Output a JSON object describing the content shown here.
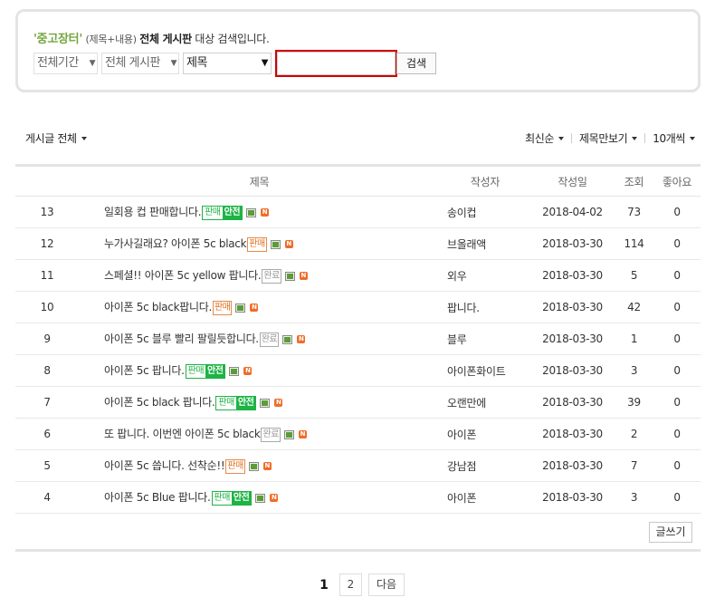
{
  "search": {
    "cafe_name": "'중고장터'",
    "scope_small": "(제목+내용)",
    "scope_bold": "전체 게시판",
    "scope_suffix": "대상 검색입니다.",
    "period": "전체기간",
    "board": "전체 게시판",
    "field": "제목",
    "query": "",
    "button": "검색"
  },
  "toolbar": {
    "filter": "게시글 전체",
    "sort": "최신순",
    "view": "제목만보기",
    "per_page": "10개씩"
  },
  "table": {
    "headers": {
      "title": "제목",
      "author": "작성자",
      "date": "작성일",
      "views": "조회",
      "likes": "좋아요"
    },
    "rows": [
      {
        "num": "13",
        "title": "일회용 컵 판매합니다.",
        "tag": "sale-safe",
        "author": "송이컵",
        "date": "2018-04-02",
        "views": "73",
        "likes": "0"
      },
      {
        "num": "12",
        "title": "누가사길래요? 아이폰 5c black",
        "tag": "sale",
        "author": "브올래액",
        "date": "2018-03-30",
        "views": "114",
        "likes": "0"
      },
      {
        "num": "11",
        "title": "스페셜!! 아이폰 5c yellow 팝니다.",
        "tag": "done",
        "author": "외우",
        "date": "2018-03-30",
        "views": "5",
        "likes": "0"
      },
      {
        "num": "10",
        "title": "아이폰 5c black팝니다.",
        "tag": "sale",
        "author": "팝니다.",
        "date": "2018-03-30",
        "views": "42",
        "likes": "0"
      },
      {
        "num": "9",
        "title": "아이폰 5c 블루 빨리 팔릴듯합니다.",
        "tag": "done",
        "author": "블루",
        "date": "2018-03-30",
        "views": "1",
        "likes": "0"
      },
      {
        "num": "8",
        "title": "아이폰 5c 팝니다.",
        "tag": "sale-safe",
        "author": "아이폰화이트",
        "date": "2018-03-30",
        "views": "3",
        "likes": "0"
      },
      {
        "num": "7",
        "title": "아이폰 5c black 팝니다.",
        "tag": "sale-safe",
        "author": "오랜만에",
        "date": "2018-03-30",
        "views": "39",
        "likes": "0"
      },
      {
        "num": "6",
        "title": "또 팝니다. 이번엔 아이폰 5c black",
        "tag": "done",
        "author": "아이폰",
        "date": "2018-03-30",
        "views": "2",
        "likes": "0"
      },
      {
        "num": "5",
        "title": "아이폰 5c 씁니다. 선착순!!",
        "tag": "sale",
        "author": "강남점",
        "date": "2018-03-30",
        "views": "7",
        "likes": "0"
      },
      {
        "num": "4",
        "title": "아이폰 5c Blue 팝니다.",
        "tag": "sale-safe",
        "author": "아이폰",
        "date": "2018-03-30",
        "views": "3",
        "likes": "0"
      }
    ]
  },
  "tags": {
    "sale": "판매",
    "safe": "안전",
    "done": "완료",
    "new": "N"
  },
  "write_button": "글쓰기",
  "pagination": {
    "current": "1",
    "next_page": "2",
    "next_label": "다음"
  }
}
